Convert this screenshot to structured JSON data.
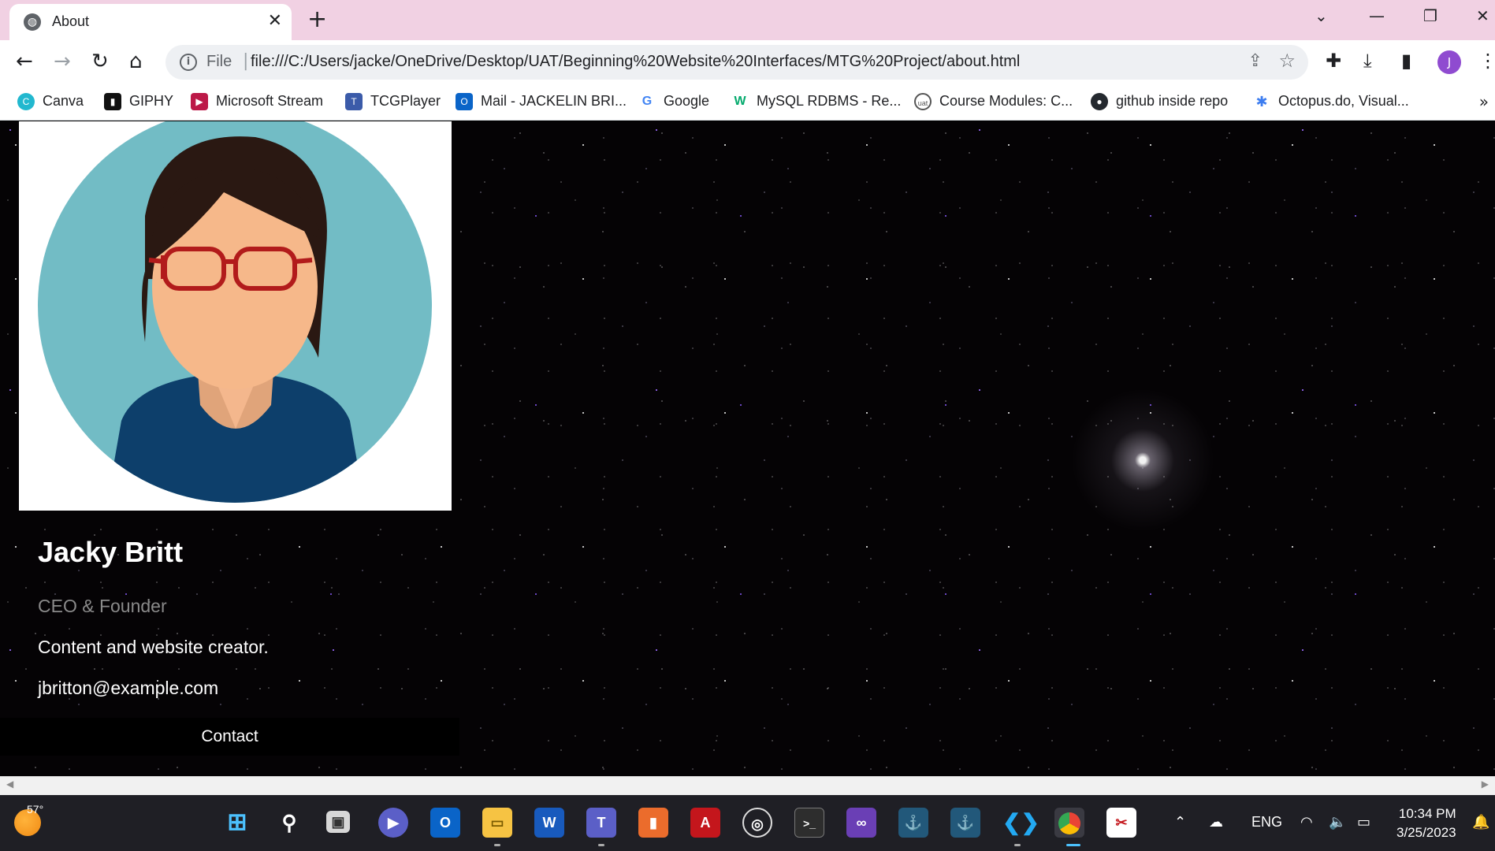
{
  "browser": {
    "tab_title": "About",
    "tab_close": "✕",
    "new_tab": "+",
    "scheme": "File",
    "url": "file:///C:/Users/jacke/OneDrive/Desktop/UAT/Beginning%20Website%20Interfaces/MTG%20Project/about.html",
    "profile_initial": "J"
  },
  "bookmarks": [
    {
      "label": "Canva",
      "icon": "canva-icon",
      "color": "#22b8cf"
    },
    {
      "label": "GIPHY",
      "icon": "giphy-icon",
      "color": "#111111"
    },
    {
      "label": "Microsoft Stream",
      "icon": "stream-icon",
      "color": "#bc1948"
    },
    {
      "label": "TCGPlayer",
      "icon": "tcgplayer-icon",
      "color": "#3b5ba9"
    },
    {
      "label": "Mail - JACKELIN BRI...",
      "icon": "outlook-icon",
      "color": "#0a64c8"
    },
    {
      "label": "Google",
      "icon": "google-icon",
      "color": "#4285f4"
    },
    {
      "label": "MySQL RDBMS - Re...",
      "icon": "w3schools-icon",
      "color": "#04aa6d"
    },
    {
      "label": "Course Modules: C...",
      "icon": "uat-icon",
      "color": "#555555"
    },
    {
      "label": "github inside repo",
      "icon": "github-icon",
      "color": "#24292f"
    },
    {
      "label": "Octopus.do, Visual...",
      "icon": "octopus-icon",
      "color": "#3d7df0"
    }
  ],
  "profile": {
    "name": "Jacky Britt",
    "role": "CEO & Founder",
    "description": "Content and website creator.",
    "email": "jbritton@example.com",
    "contact_label": "Contact"
  },
  "taskbar": {
    "weather_temp": "57°",
    "language": "ENG",
    "time": "10:34 PM",
    "date": "3/25/2023",
    "apps": [
      "windows-start-icon",
      "search-icon",
      "task-view-icon",
      "teams-meet-icon",
      "outlook-icon",
      "file-explorer-icon",
      "word-icon",
      "teams-icon",
      "office-icon",
      "acrobat-icon",
      "obs-icon",
      "terminal-icon",
      "visual-studio-icon",
      "mysql-workbench-icon",
      "mysql-workbench-2-icon",
      "vscode-icon",
      "chrome-icon",
      "snipping-tool-icon"
    ]
  }
}
